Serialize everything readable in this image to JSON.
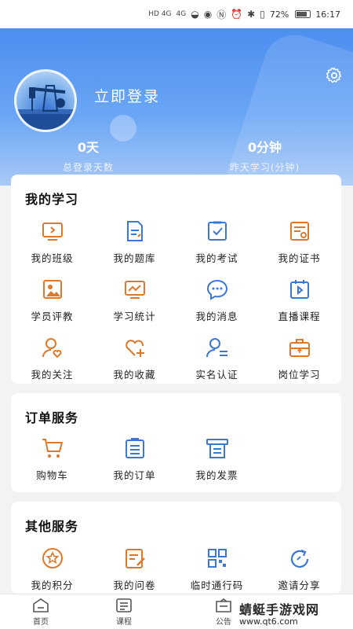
{
  "status_bar": {
    "network_left": "HD 4G",
    "network_right": "4G",
    "battery": "72%",
    "time": "16:17"
  },
  "header": {
    "login_text": "立即登录",
    "stats": [
      {
        "value": "0天",
        "label": "总登录天数"
      },
      {
        "value": "0分钟",
        "label": "昨天学习(分钟)"
      }
    ]
  },
  "my_learning": {
    "title": "我的学习",
    "items": [
      {
        "label": "我的班级",
        "icon": "class-icon"
      },
      {
        "label": "我的题库",
        "icon": "question-bank-icon"
      },
      {
        "label": "我的考试",
        "icon": "exam-icon"
      },
      {
        "label": "我的证书",
        "icon": "certificate-icon"
      },
      {
        "label": "学员评教",
        "icon": "evaluation-icon"
      },
      {
        "label": "学习统计",
        "icon": "statistics-icon"
      },
      {
        "label": "我的消息",
        "icon": "message-icon"
      },
      {
        "label": "直播课程",
        "icon": "live-course-icon"
      },
      {
        "label": "我的关注",
        "icon": "follow-icon"
      },
      {
        "label": "我的收藏",
        "icon": "favorite-icon"
      },
      {
        "label": "实名认证",
        "icon": "verify-icon"
      },
      {
        "label": "岗位学习",
        "icon": "job-learning-icon"
      }
    ]
  },
  "order_service": {
    "title": "订单服务",
    "items": [
      {
        "label": "购物车",
        "icon": "cart-icon"
      },
      {
        "label": "我的订单",
        "icon": "order-icon"
      },
      {
        "label": "我的发票",
        "icon": "invoice-icon"
      }
    ]
  },
  "other_service": {
    "title": "其他服务",
    "items": [
      {
        "label": "我的积分",
        "icon": "points-icon"
      },
      {
        "label": "我的问卷",
        "icon": "survey-icon"
      },
      {
        "label": "临时通行码",
        "icon": "qrcode-icon"
      },
      {
        "label": "邀请分享",
        "icon": "share-icon"
      }
    ]
  },
  "bottom_nav": [
    {
      "label": "首页",
      "icon": "home-icon"
    },
    {
      "label": "课程",
      "icon": "course-icon"
    },
    {
      "label": "公告",
      "icon": "notice-icon"
    }
  ],
  "watermark": {
    "title": "蜻蜓手游戏网",
    "url": "www.qt6.com"
  },
  "colors": {
    "accent_orange": "#e0782a",
    "accent_blue": "#3a78d4",
    "header_blue": "#4c8ef0"
  }
}
